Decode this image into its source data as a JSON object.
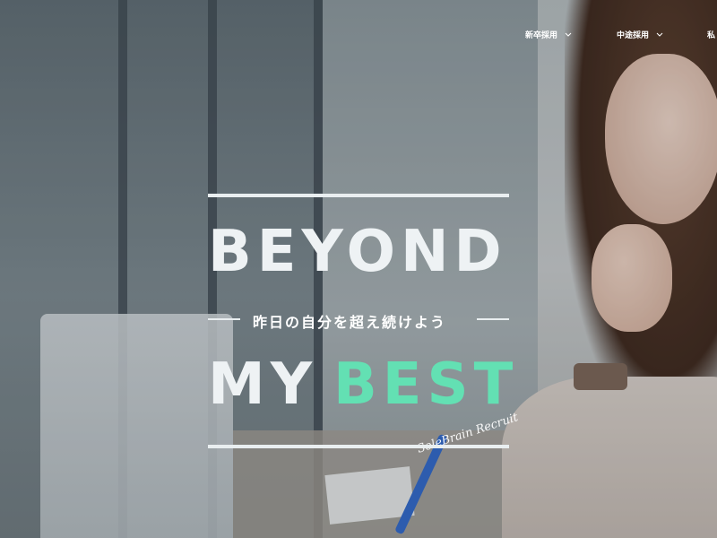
{
  "nav": {
    "items": [
      {
        "label": "新卒採用",
        "icon": "chevron-down-icon"
      },
      {
        "label": "中途採用",
        "icon": "chevron-down-icon"
      },
      {
        "label": "私"
      }
    ]
  },
  "hero": {
    "headline_top": "BEYOND",
    "tagline": "昨日の自分を超え続けよう",
    "headline_bottom_1": "MY",
    "headline_bottom_2": "BEST",
    "signature": "SoleBrain Recruit"
  },
  "colors": {
    "accent": "#63e0b3",
    "text": "#eef2f4"
  }
}
